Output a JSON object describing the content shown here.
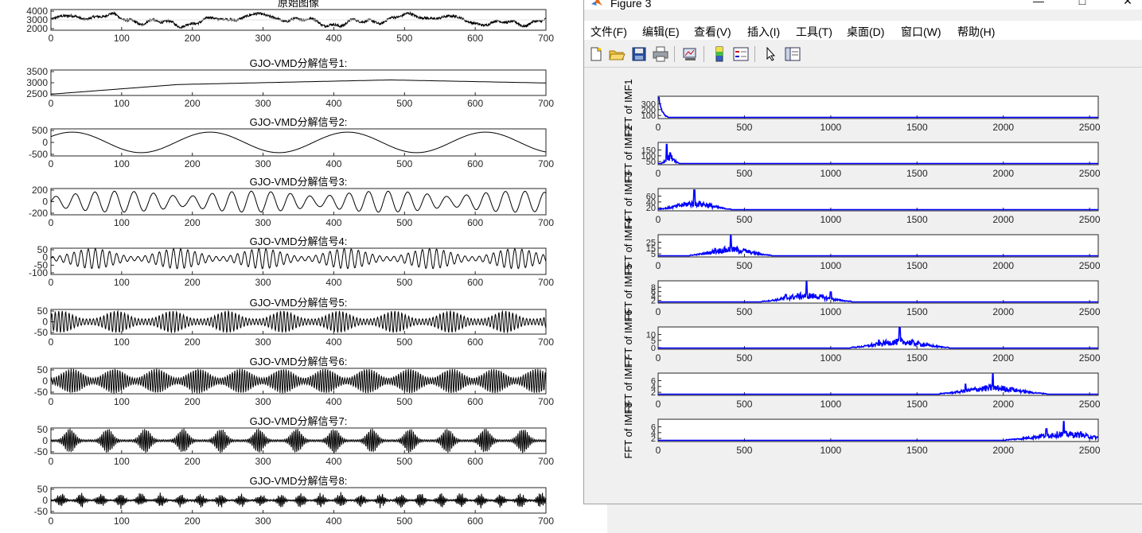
{
  "left_figure": {
    "panel_titles": [
      "原始图像",
      "GJO-VMD分解信号1:",
      "GJO-VMD分解信号2:",
      "GJO-VMD分解信号3:",
      "GJO-VMD分解信号4:",
      "GJO-VMD分解信号5:",
      "GJO-VMD分解信号6:",
      "GJO-VMD分解信号7:",
      "GJO-VMD分解信号8:"
    ],
    "x_ticks": [
      "0",
      "100",
      "200",
      "300",
      "400",
      "500",
      "600",
      "700"
    ]
  },
  "figure3": {
    "title": "Figure 3",
    "colors": {
      "line": "#0000ff",
      "background": "#f0f0f0"
    },
    "menu": [
      "文件(F)",
      "编辑(E)",
      "查看(V)",
      "插入(I)",
      "工具(T)",
      "桌面(D)",
      "窗口(W)",
      "帮助(H)"
    ],
    "toolbar_icons": [
      "new-file-icon",
      "open-folder-icon",
      "save-icon",
      "print-icon",
      "link-figure-icon",
      "colorbar-icon",
      "legend-icon",
      "pointer-icon",
      "property-editor-icon"
    ],
    "x_ticks": [
      "0",
      "500",
      "1000",
      "1500",
      "2000",
      "2500"
    ],
    "panel_ylabels": [
      "FFT of IMF1",
      "FFT of IMF2",
      "FFT of IMF3",
      "FFT of IMF4",
      "FFT of IMF5",
      "FFT of IMF6",
      "FFT of IMF7",
      "FFT of IMF8"
    ]
  },
  "chart_data": [
    {
      "type": "line",
      "title": "原始图像",
      "x": [
        0,
        100,
        200,
        300,
        400,
        500,
        600,
        700
      ],
      "series": [
        {
          "values": [
            2800,
            2600,
            3400,
            2900,
            3200,
            3300,
            3000,
            3100
          ]
        }
      ],
      "ylim": [
        2000,
        4000
      ],
      "yticks": [
        "2000",
        "3000",
        "4000"
      ]
    },
    {
      "type": "line",
      "title": "GJO-VMD分解信号1:",
      "x": [
        0,
        50,
        100,
        150,
        200,
        300,
        400,
        480,
        600,
        700
      ],
      "series": [
        {
          "values": [
            2520,
            2500,
            2650,
            2880,
            2930,
            2900,
            3080,
            3380,
            3250,
            3150
          ]
        }
      ],
      "ylim": [
        2500,
        3500
      ],
      "yticks": [
        "2500",
        "3000",
        "3500"
      ]
    },
    {
      "type": "line",
      "title": "GJO-VMD分解信号2:",
      "series": [
        {
          "values": [
            200,
            -300,
            400,
            -350,
            300,
            -300,
            350,
            -300
          ]
        }
      ],
      "ylim": [
        -500,
        500
      ],
      "yticks": [
        "-500",
        "0",
        "500"
      ]
    },
    {
      "type": "line",
      "title": "GJO-VMD分解信号3:",
      "series": [
        {
          "values": [
            100,
            -150,
            200,
            -150,
            150,
            -100
          ]
        }
      ],
      "ylim": [
        -200,
        200
      ],
      "yticks": [
        "-200",
        "0",
        "200"
      ]
    },
    {
      "type": "line",
      "title": "GJO-VMD分解信号4:",
      "series": [
        {
          "values": [
            50,
            -60,
            80,
            -90,
            70,
            -80
          ]
        }
      ],
      "ylim": [
        -100,
        60
      ],
      "yticks": [
        "-100",
        "-50",
        "0",
        "50"
      ]
    },
    {
      "type": "line",
      "title": "GJO-VMD分解信号5:",
      "series": [
        {
          "values": [
            40,
            -40,
            30,
            -30,
            50,
            -50
          ]
        }
      ],
      "ylim": [
        -50,
        50
      ],
      "yticks": [
        "-50",
        "0",
        "50"
      ]
    },
    {
      "type": "line",
      "title": "GJO-VMD分解信号6:",
      "series": [
        {
          "values": [
            50,
            -50,
            40,
            -40,
            50,
            -50
          ]
        }
      ],
      "ylim": [
        -50,
        60
      ],
      "yticks": [
        "-50",
        "0",
        "50"
      ]
    },
    {
      "type": "line",
      "title": "GJO-VMD分解信号7:",
      "series": [
        {
          "values": [
            30,
            -30,
            50,
            -50,
            20,
            -20
          ]
        }
      ],
      "ylim": [
        -50,
        50
      ],
      "yticks": [
        "-50",
        "0",
        "50"
      ]
    },
    {
      "type": "line",
      "title": "GJO-VMD分解信号8:",
      "series": [
        {
          "values": [
            30,
            -30,
            20,
            -20,
            30,
            -30
          ]
        }
      ],
      "ylim": [
        -50,
        50
      ],
      "yticks": [
        "-50",
        "0",
        "50"
      ]
    },
    {
      "type": "line",
      "ylabel": "FFT of IMF1",
      "xlim": [
        0,
        2550
      ],
      "ylim": [
        0,
        350
      ],
      "yticks": [
        "100",
        "200",
        "300"
      ],
      "peaks": [
        {
          "x": 5,
          "y": 340
        },
        {
          "x": 15,
          "y": 150
        },
        {
          "x": 30,
          "y": 60
        }
      ]
    },
    {
      "type": "line",
      "ylabel": "FFT of IMF2",
      "xlim": [
        0,
        2550
      ],
      "ylim": [
        0,
        170
      ],
      "yticks": [
        "50",
        "100",
        "150"
      ],
      "peaks": [
        {
          "x": 50,
          "y": 160
        },
        {
          "x": 70,
          "y": 90
        },
        {
          "x": 90,
          "y": 40
        }
      ]
    },
    {
      "type": "line",
      "ylabel": "FFT of IMF3",
      "xlim": [
        0,
        2550
      ],
      "ylim": [
        0,
        60
      ],
      "yticks": [
        "20",
        "40",
        "60"
      ],
      "peaks": [
        {
          "x": 160,
          "y": 15
        },
        {
          "x": 210,
          "y": 58
        },
        {
          "x": 260,
          "y": 10
        }
      ]
    },
    {
      "type": "line",
      "ylabel": "FFT of IMF4",
      "xlim": [
        0,
        2550
      ],
      "ylim": [
        0,
        27
      ],
      "yticks": [
        "5",
        "15",
        "25"
      ],
      "peaks": [
        {
          "x": 330,
          "y": 10
        },
        {
          "x": 420,
          "y": 27
        },
        {
          "x": 500,
          "y": 8
        }
      ]
    },
    {
      "type": "line",
      "ylabel": "FFT of IMF5",
      "xlim": [
        0,
        2550
      ],
      "ylim": [
        0,
        8
      ],
      "yticks": [
        "2",
        "4",
        "6",
        "8"
      ],
      "peaks": [
        {
          "x": 740,
          "y": 3
        },
        {
          "x": 860,
          "y": 8
        },
        {
          "x": 1000,
          "y": 4
        }
      ]
    },
    {
      "type": "line",
      "ylabel": "FFT of IMF6",
      "xlim": [
        0,
        2550
      ],
      "ylim": [
        0,
        10
      ],
      "yticks": [
        "0",
        "5",
        "10"
      ],
      "peaks": [
        {
          "x": 1280,
          "y": 4
        },
        {
          "x": 1400,
          "y": 10
        },
        {
          "x": 1480,
          "y": 3
        }
      ]
    },
    {
      "type": "line",
      "ylabel": "FFT of IMF7",
      "xlim": [
        0,
        2550
      ],
      "ylim": [
        0,
        6
      ],
      "yticks": [
        "2",
        "4",
        "6"
      ],
      "peaks": [
        {
          "x": 1780,
          "y": 3
        },
        {
          "x": 1940,
          "y": 6
        },
        {
          "x": 2050,
          "y": 2
        }
      ]
    },
    {
      "type": "line",
      "ylabel": "FFT of IMF8",
      "xlim": [
        0,
        2550
      ],
      "ylim": [
        0,
        7
      ],
      "yticks": [
        "2",
        "4",
        "6"
      ],
      "peaks": [
        {
          "x": 2250,
          "y": 4
        },
        {
          "x": 2350,
          "y": 6.5
        },
        {
          "x": 2450,
          "y": 3
        }
      ]
    }
  ]
}
